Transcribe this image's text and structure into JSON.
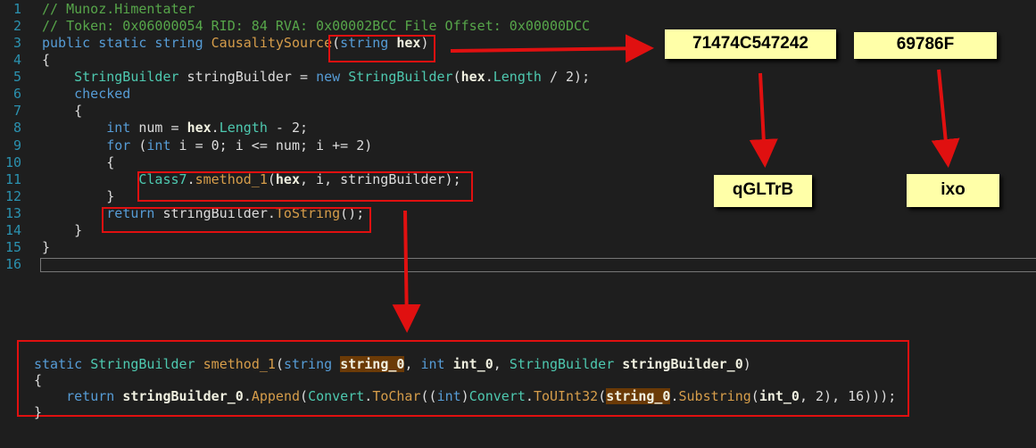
{
  "editor": {
    "lines": [
      [
        [
          "// Munoz.Himentater",
          "c"
        ]
      ],
      [
        [
          "// Token: 0x06000054 RID: 84 RVA: 0x00002BCC File Offset: 0x00000DCC",
          "c"
        ]
      ],
      [
        [
          "public static string ",
          "k"
        ],
        [
          "CausalitySource",
          "m"
        ],
        [
          "(",
          "o"
        ],
        [
          "string ",
          "k"
        ],
        [
          "hex",
          "p"
        ],
        [
          ")",
          "o"
        ]
      ],
      [
        [
          "{",
          "o"
        ]
      ],
      [
        [
          "    "
        ],
        [
          "StringBuilder",
          "t"
        ],
        [
          " stringBuilder = ",
          "o"
        ],
        [
          "new ",
          "k"
        ],
        [
          "StringBuilder",
          "t"
        ],
        [
          "(",
          "o"
        ],
        [
          "hex",
          "p"
        ],
        [
          ".",
          "o"
        ],
        [
          "Length",
          "t"
        ],
        [
          " / 2);",
          "o"
        ]
      ],
      [
        [
          "    "
        ],
        [
          "checked",
          "k"
        ]
      ],
      [
        [
          "    {",
          "o"
        ]
      ],
      [
        [
          "        "
        ],
        [
          "int",
          "k"
        ],
        [
          " num = ",
          "o"
        ],
        [
          "hex",
          "p"
        ],
        [
          ".",
          "o"
        ],
        [
          "Length",
          "t"
        ],
        [
          " - 2;",
          "o"
        ]
      ],
      [
        [
          "        "
        ],
        [
          "for",
          "k"
        ],
        [
          " (",
          "o"
        ],
        [
          "int",
          "k"
        ],
        [
          " i = 0; i <= num; i += 2)",
          "o"
        ]
      ],
      [
        [
          "        {",
          "o"
        ]
      ],
      [
        [
          "            "
        ],
        [
          "Class7",
          "t"
        ],
        [
          ".",
          "o"
        ],
        [
          "smethod_1",
          "m"
        ],
        [
          "(",
          "o"
        ],
        [
          "hex",
          "p"
        ],
        [
          ", i, stringBuilder);",
          "o"
        ]
      ],
      [
        [
          "        }",
          "o"
        ]
      ],
      [
        [
          "        "
        ],
        [
          "return",
          "k"
        ],
        [
          " stringBuilder.",
          "o"
        ],
        [
          "ToString",
          "m"
        ],
        [
          "();",
          "o"
        ]
      ],
      [
        [
          "    }",
          "o"
        ]
      ],
      [
        [
          "}",
          "o"
        ]
      ],
      [
        [
          ""
        ]
      ]
    ]
  },
  "popup": {
    "lines": [
      [
        [
          "static ",
          "k"
        ],
        [
          "StringBuilder",
          "t"
        ],
        [
          " ",
          "o"
        ],
        [
          "smethod_1",
          "m"
        ],
        [
          "(",
          "o"
        ],
        [
          "string ",
          "k"
        ],
        [
          "string_0",
          "h"
        ],
        [
          ", ",
          "o"
        ],
        [
          "int ",
          "k"
        ],
        [
          "int_0",
          "p"
        ],
        [
          ", ",
          "o"
        ],
        [
          "StringBuilder",
          "t"
        ],
        [
          " ",
          "o"
        ],
        [
          "stringBuilder_0",
          "p"
        ],
        [
          ")",
          "o"
        ]
      ],
      [
        [
          "{",
          "o"
        ]
      ],
      [
        [
          "    "
        ],
        [
          "return ",
          "k"
        ],
        [
          "stringBuilder_0",
          "p"
        ],
        [
          ".",
          "o"
        ],
        [
          "Append",
          "m"
        ],
        [
          "(",
          "o"
        ],
        [
          "Convert",
          "t"
        ],
        [
          ".",
          "o"
        ],
        [
          "ToChar",
          "m"
        ],
        [
          "((",
          "o"
        ],
        [
          "int",
          "k"
        ],
        [
          ")",
          "o"
        ],
        [
          "Convert",
          "t"
        ],
        [
          ".",
          "o"
        ],
        [
          "ToUInt32",
          "m"
        ],
        [
          "(",
          "o"
        ],
        [
          "string_0",
          "h"
        ],
        [
          ".",
          "o"
        ],
        [
          "Substring",
          "m"
        ],
        [
          "(",
          "o"
        ],
        [
          "int_0",
          "p"
        ],
        [
          ", 2), 16)));",
          "o"
        ]
      ],
      [
        [
          "}",
          "o"
        ]
      ]
    ]
  },
  "notes": {
    "hex1": "71474C547242",
    "hex2": "69786F",
    "out1": "qGLTrB",
    "out2": "ixo"
  },
  "colors": {
    "annotation": "#e01010",
    "note_bg": "#ffffa8"
  }
}
